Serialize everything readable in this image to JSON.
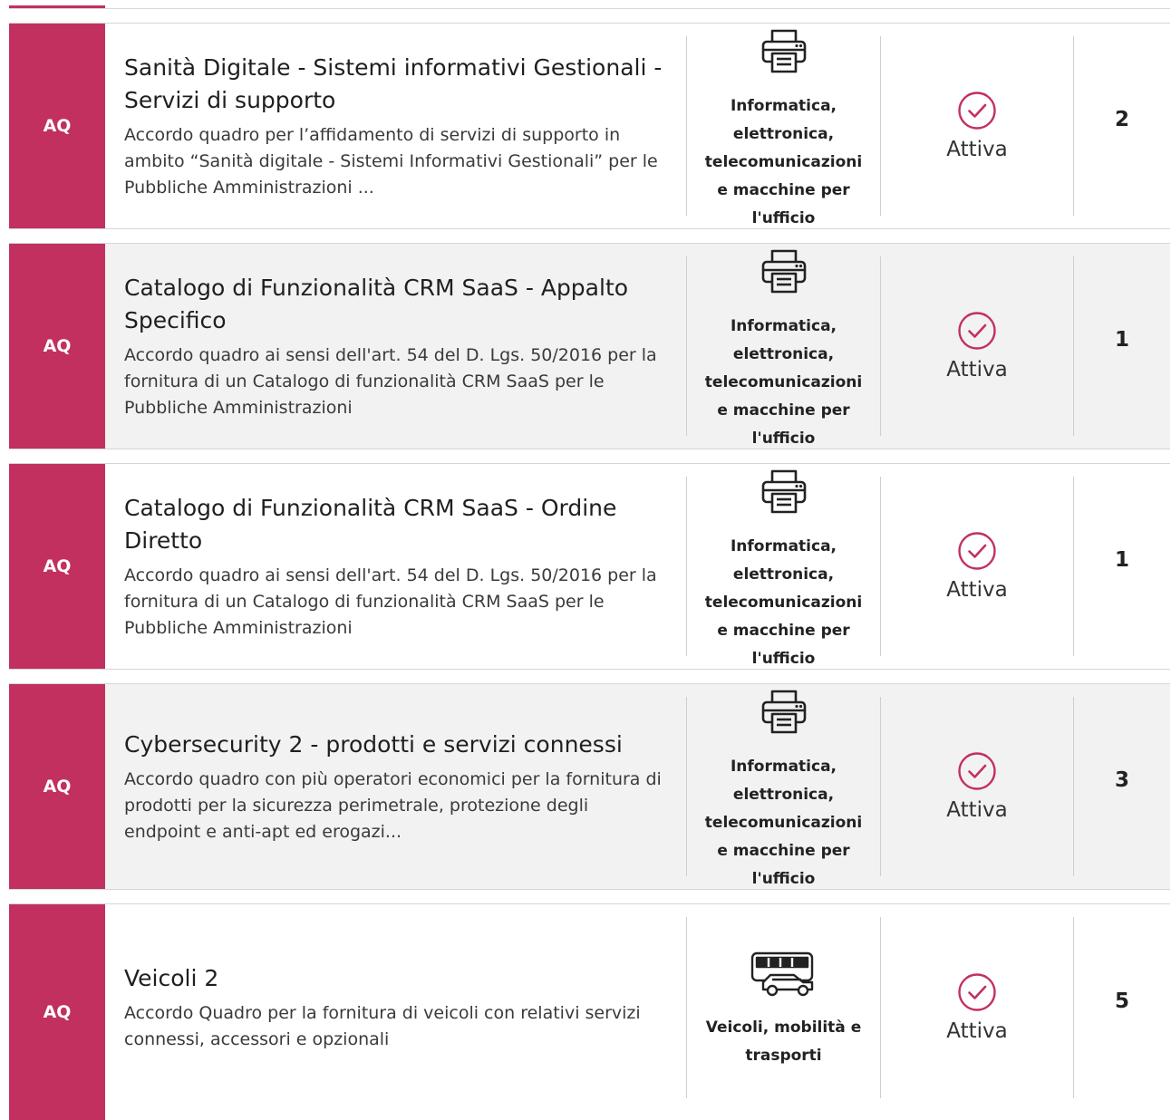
{
  "colors": {
    "accent": "#c2305f",
    "alt_row": "#f2f2f2"
  },
  "rows": [
    {
      "type": "AQ",
      "title": "Sanità Digitale - Sistemi informativi Gestionali - Servizi di supporto",
      "description": "Accordo quadro per l’affidamento di servizi di supporto in ambito “Sanità digitale - Sistemi Informativi Gestionali” per le Pubbliche Amministrazioni ...",
      "category_icon": "printer-icon",
      "category": "Informatica, elettronica, telecomunicazioni e macchine per l'ufficio",
      "status_icon": "check-circle-icon",
      "status": "Attiva",
      "count": "2"
    },
    {
      "type": "AQ",
      "title": "Catalogo di Funzionalità CRM SaaS - Appalto Specifico",
      "description": "Accordo quadro ai sensi dell'art. 54 del D. Lgs. 50/2016 per la fornitura di un Catalogo di funzionalità CRM SaaS per le Pubbliche Amministrazioni",
      "category_icon": "printer-icon",
      "category": "Informatica, elettronica, telecomunicazioni e macchine per l'ufficio",
      "status_icon": "check-circle-icon",
      "status": "Attiva",
      "count": "1"
    },
    {
      "type": "AQ",
      "title": "Catalogo di Funzionalità CRM SaaS - Ordine Diretto",
      "description": "Accordo quadro ai sensi dell'art. 54 del D. Lgs. 50/2016 per la fornitura di un Catalogo di funzionalità CRM SaaS per le Pubbliche Amministrazioni",
      "category_icon": "printer-icon",
      "category": "Informatica, elettronica, telecomunicazioni e macchine per l'ufficio",
      "status_icon": "check-circle-icon",
      "status": "Attiva",
      "count": "1"
    },
    {
      "type": "AQ",
      "title": "Cybersecurity 2 - prodotti e servizi connessi",
      "description": "Accordo quadro con più operatori economici per la fornitura di prodotti per la sicurezza perimetrale, protezione degli endpoint e anti-apt ed erogazi...",
      "category_icon": "printer-icon",
      "category": "Informatica, elettronica, telecomunicazioni e macchine per l'ufficio",
      "status_icon": "check-circle-icon",
      "status": "Attiva",
      "count": "3"
    },
    {
      "type": "AQ",
      "title": "Veicoli 2",
      "description": "Accordo Quadro per la fornitura di veicoli con relativi servizi connessi, accessori e opzionali",
      "category_icon": "bus-car-icon",
      "category": "Veicoli, mobilità e trasporti",
      "status_icon": "check-circle-icon",
      "status": "Attiva",
      "count": "5"
    }
  ]
}
